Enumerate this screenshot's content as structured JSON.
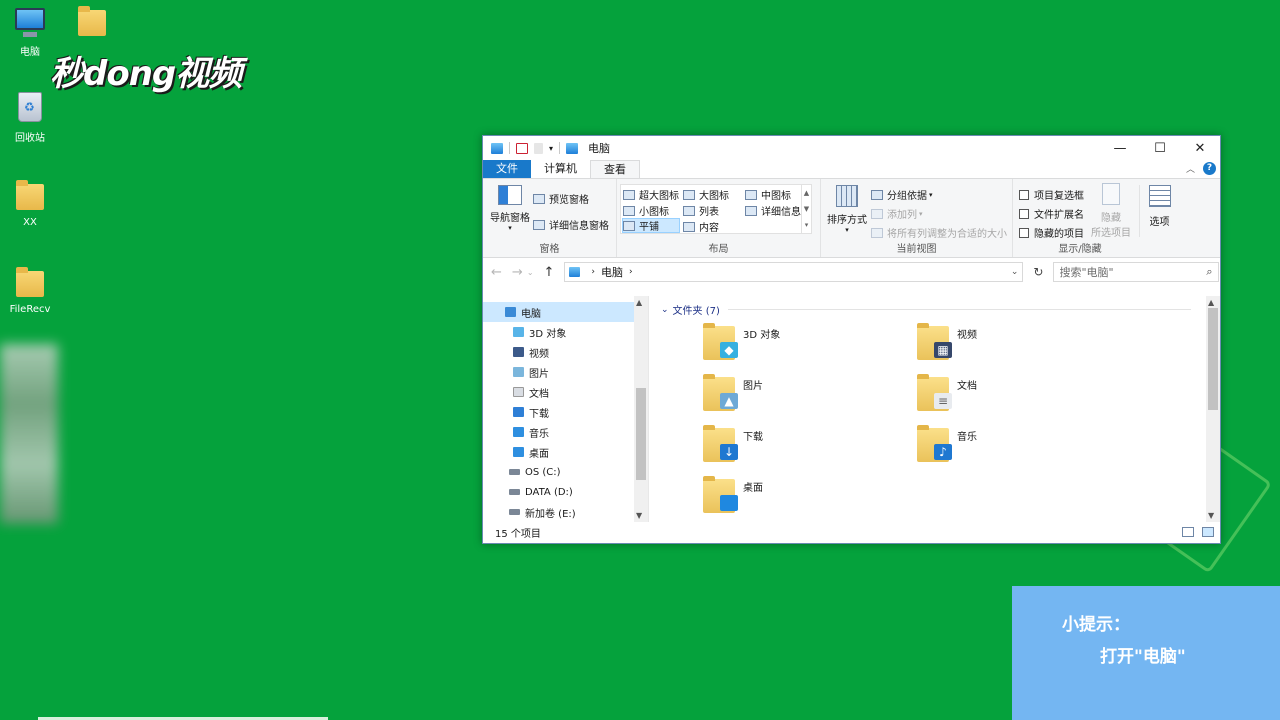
{
  "desktop": {
    "icons": [
      {
        "label": "电脑"
      },
      {
        "label": ""
      },
      {
        "label": "回收站"
      },
      {
        "label": "XX"
      },
      {
        "label": "FileRecv"
      }
    ],
    "logo_text": "秒dong视频"
  },
  "window": {
    "title": "电脑",
    "controls": {
      "minimize": "—",
      "maximize": "☐",
      "close": "✕"
    },
    "tabs": [
      {
        "label": "文件"
      },
      {
        "label": "计算机"
      },
      {
        "label": "查看"
      }
    ],
    "ribbon": {
      "panes": {
        "label": "窗格",
        "nav_pane": "导航窗格",
        "preview_pane": "预览窗格",
        "details_pane": "详细信息窗格"
      },
      "layout": {
        "label": "布局",
        "items": [
          "超大图标",
          "大图标",
          "中图标",
          "小图标",
          "列表",
          "详细信息",
          "平铺",
          "内容"
        ]
      },
      "current_view": {
        "label": "当前视图",
        "sort_by": "排序方式",
        "group_by": "分组依据",
        "add_columns": "添加列",
        "size_all_columns": "将所有列调整为合适的大小"
      },
      "show_hide": {
        "label": "显示/隐藏",
        "item_checkboxes": "项目复选框",
        "file_extensions": "文件扩展名",
        "hidden_items": "隐藏的项目",
        "hide_selected_line1": "隐藏",
        "hide_selected_line2": "所选项目",
        "options": "选项"
      }
    },
    "address": {
      "path": "电脑",
      "search_placeholder": "搜索\"电脑\""
    },
    "nav_items": [
      {
        "label": "电脑",
        "color": "#3a8ad6"
      },
      {
        "label": "3D 对象",
        "color": "#58b4e8"
      },
      {
        "label": "视频",
        "color": "#3c5a8a"
      },
      {
        "label": "图片",
        "color": "#7bb6dc"
      },
      {
        "label": "文档",
        "color": "#d9dde3"
      },
      {
        "label": "下载",
        "color": "#2e7fd6"
      },
      {
        "label": "音乐",
        "color": "#2e8fe0"
      },
      {
        "label": "桌面",
        "color": "#2e8fe0"
      },
      {
        "label": "OS (C:)",
        "color": "#7b8796"
      },
      {
        "label": "DATA (D:)",
        "color": "#7b8796"
      },
      {
        "label": "新加卷 (E:)",
        "color": "#7b8796"
      }
    ],
    "group_header": "文件夹 (7)",
    "folders": [
      {
        "label": "3D 对象",
        "badge": "◆",
        "badge_color": "#36b0e0"
      },
      {
        "label": "视频",
        "badge": "▦",
        "badge_color": "#36476b"
      },
      {
        "label": "图片",
        "badge": "▲",
        "badge_color": "#6ea9d6"
      },
      {
        "label": "文档",
        "badge": "≡",
        "badge_color": "#e8ebef"
      },
      {
        "label": "下载",
        "badge": "↓",
        "badge_color": "#1f78d1"
      },
      {
        "label": "音乐",
        "badge": "♪",
        "badge_color": "#1f78d1"
      },
      {
        "label": "桌面",
        "badge": "",
        "badge_color": "#1f88e0"
      }
    ],
    "status": "15 个项目"
  },
  "tip": {
    "line1": "小提示：",
    "line2": "打开\"电脑\""
  }
}
